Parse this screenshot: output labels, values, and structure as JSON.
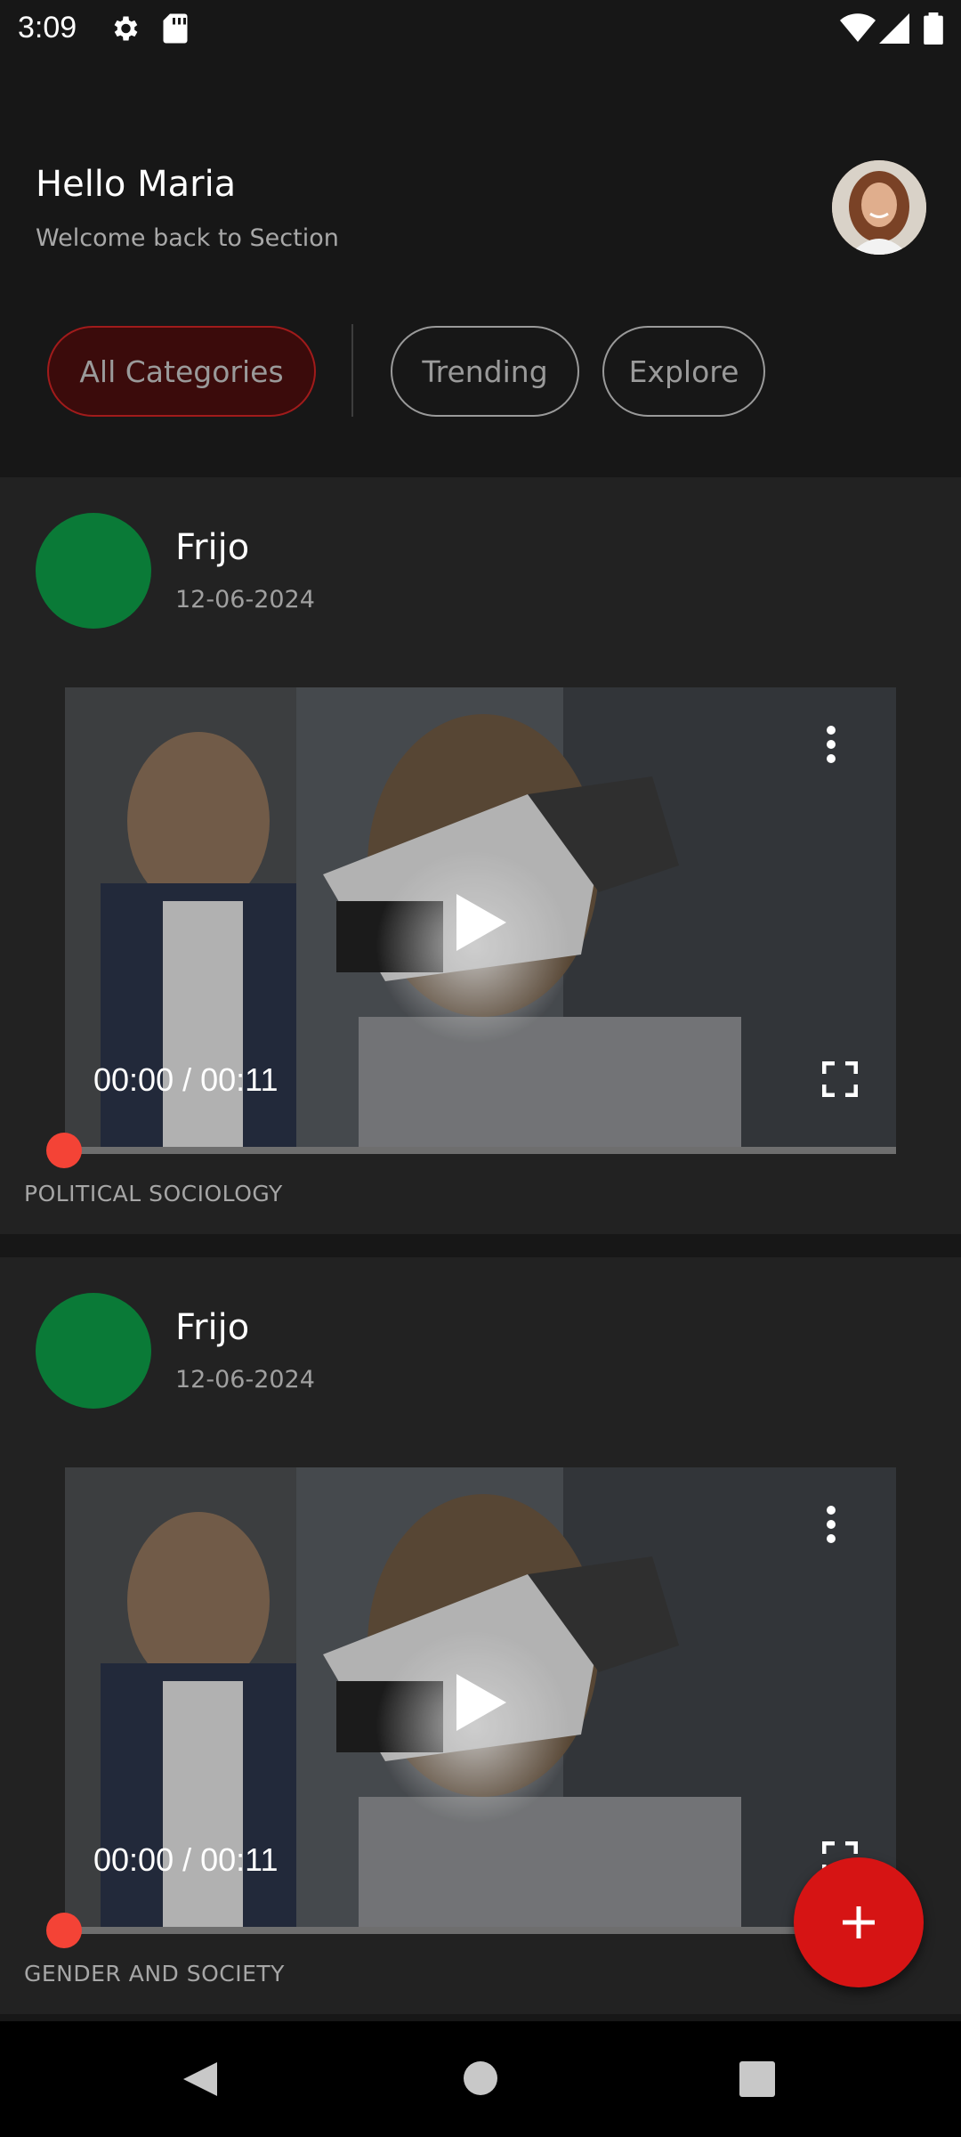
{
  "status_bar": {
    "time": "3:09",
    "icons": [
      "settings-icon",
      "sd-card-icon",
      "wifi-icon",
      "signal-icon",
      "battery-icon"
    ]
  },
  "header": {
    "greeting": "Hello Maria",
    "subtitle": "Welcome back to Section"
  },
  "categories": [
    {
      "label": "All Categories",
      "active": true
    },
    {
      "label": "Trending",
      "active": false
    },
    {
      "label": "Explore",
      "active": false
    }
  ],
  "posts": [
    {
      "author": "Frijo",
      "date": "12-06-2024",
      "time_display": "00:00 / 00:11",
      "category": "POLITICAL SOCIOLOGY",
      "progress": 0
    },
    {
      "author": "Frijo",
      "date": "12-06-2024",
      "time_display": "00:00 / 00:11",
      "category": "GENDER AND SOCIETY",
      "progress": 0
    }
  ],
  "fab": {
    "icon": "plus-icon"
  },
  "colors": {
    "accent": "#d61414",
    "active_chip_bg": "#3b0b0b",
    "author_avatar": "#0a7a37",
    "progress_knob": "#f44336"
  }
}
